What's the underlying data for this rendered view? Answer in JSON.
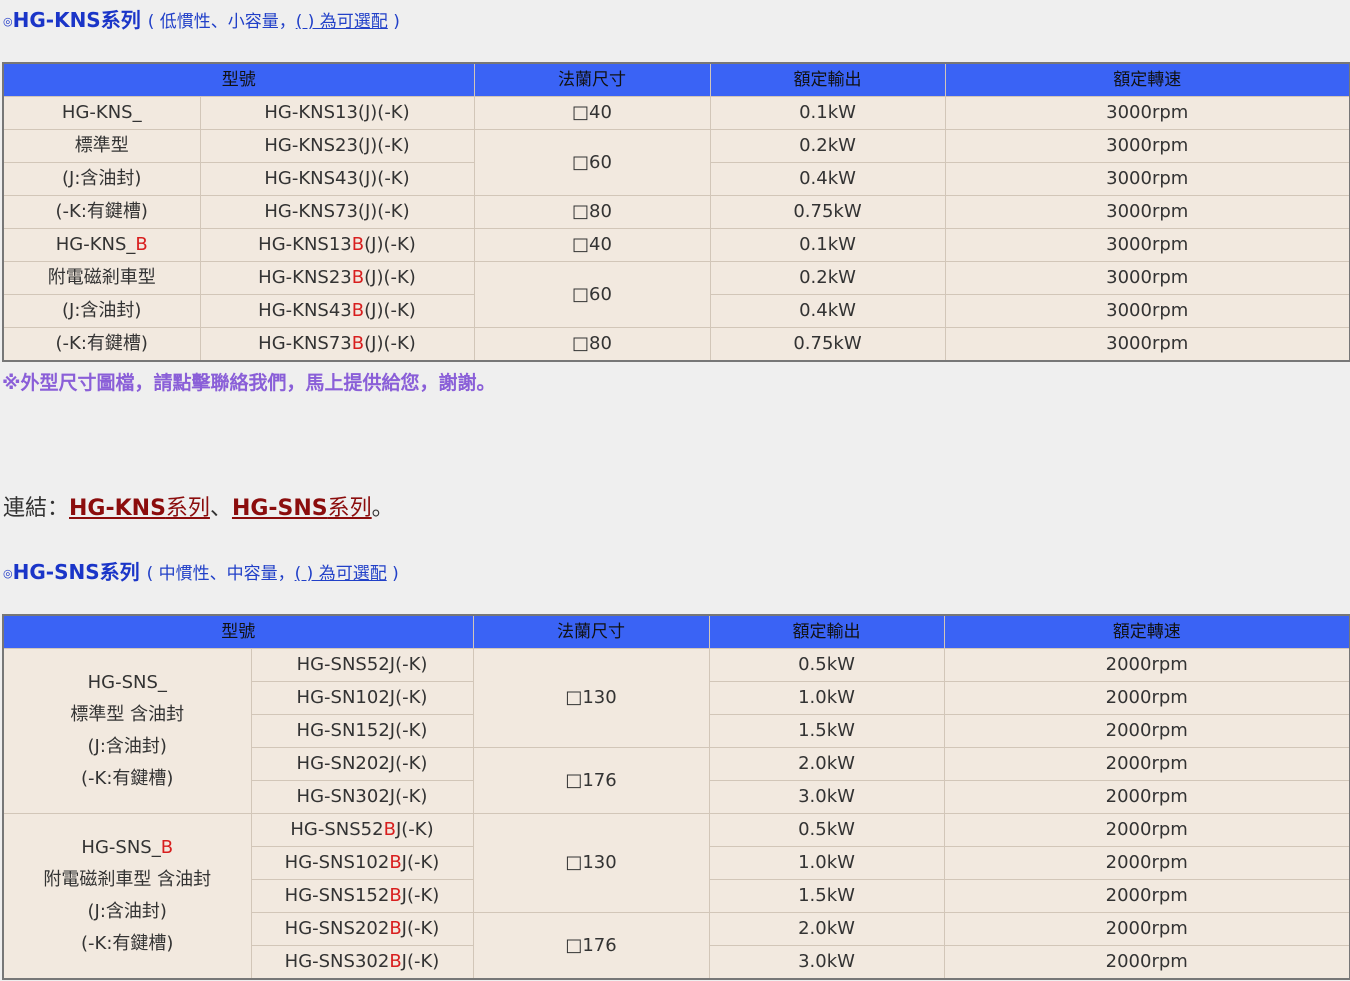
{
  "kns": {
    "bullet": "◎",
    "title": "HG-KNS系列",
    "sub_pre": "( 低慣性、小容量，",
    "sub_link": "( ) 為可選配",
    "sub_post": " )",
    "headers": [
      "型號",
      "法蘭尺寸",
      "額定輸出",
      "額定轉速"
    ],
    "group1": {
      "line1": "HG-KNS_",
      "line2": "標準型",
      "line3": "(J:含油封)",
      "line4": "(-K:有鍵槽)"
    },
    "group2": {
      "line1": "HG-KNS_",
      "line1_red": "B",
      "line2": "附電磁剎車型",
      "line3": "(J:含油封)",
      "line4": "(-K:有鍵槽)"
    },
    "rows": [
      {
        "model": "HG-KNS13(J)(-K)",
        "output": "0.1kW",
        "speed": "3000rpm"
      },
      {
        "model": "HG-KNS23(J)(-K)",
        "output": "0.2kW",
        "speed": "3000rpm"
      },
      {
        "model": "HG-KNS43(J)(-K)",
        "output": "0.4kW",
        "speed": "3000rpm"
      },
      {
        "model": "HG-KNS73(J)(-K)",
        "output": "0.75kW",
        "speed": "3000rpm"
      }
    ],
    "rows_b": [
      {
        "pre": "HG-KNS13",
        "red": "B",
        "post": "(J)(-K)",
        "output": "0.1kW",
        "speed": "3000rpm"
      },
      {
        "pre": "HG-KNS23",
        "red": "B",
        "post": "(J)(-K)",
        "output": "0.2kW",
        "speed": "3000rpm"
      },
      {
        "pre": "HG-KNS43",
        "red": "B",
        "post": "(J)(-K)",
        "output": "0.4kW",
        "speed": "3000rpm"
      },
      {
        "pre": "HG-KNS73",
        "red": "B",
        "post": "(J)(-K)",
        "output": "0.75kW",
        "speed": "3000rpm"
      }
    ],
    "flange": {
      "f40": "□40",
      "f60": "□60",
      "f80": "□80"
    }
  },
  "note": "※外型尺寸圖檔，請點擊聯絡我們，馬上提供給您，謝謝。",
  "links": {
    "prefix": "連結：",
    "kns_bold": "HG-KNS",
    "kns_rest": "系列",
    "sep": "、",
    "sns_bold": "HG-SNS",
    "sns_rest": "系列",
    "suffix": "。"
  },
  "sns": {
    "bullet": "◎",
    "title": "HG-SNS系列",
    "sub_pre": "( 中慣性、中容量，",
    "sub_link": "( ) 為可選配",
    "sub_post": " )",
    "headers": [
      "型號",
      "法蘭尺寸",
      "額定輸出",
      "額定轉速"
    ],
    "group1": {
      "line1": "HG-SNS_",
      "line2": "標準型 含油封",
      "line3": "(J:含油封)",
      "line4": "(-K:有鍵槽)"
    },
    "group2": {
      "line1": "HG-SNS_",
      "line1_red": "B",
      "line2": "附電磁剎車型 含油封",
      "line3": "(J:含油封)",
      "line4": "(-K:有鍵槽)"
    },
    "rows": [
      {
        "model": "HG-SNS52J(-K)",
        "output": "0.5kW",
        "speed": "2000rpm"
      },
      {
        "model": "HG-SN102J(-K)",
        "output": "1.0kW",
        "speed": "2000rpm"
      },
      {
        "model": "HG-SN152J(-K)",
        "output": "1.5kW",
        "speed": "2000rpm"
      },
      {
        "model": "HG-SN202J(-K)",
        "output": "2.0kW",
        "speed": "2000rpm"
      },
      {
        "model": "HG-SN302J(-K)",
        "output": "3.0kW",
        "speed": "2000rpm"
      }
    ],
    "rows_b": [
      {
        "pre": "HG-SNS52",
        "red": "B",
        "post": "J(-K)",
        "output": "0.5kW",
        "speed": "2000rpm"
      },
      {
        "pre": "HG-SNS102",
        "red": "B",
        "post": "J(-K)",
        "output": "1.0kW",
        "speed": "2000rpm"
      },
      {
        "pre": "HG-SNS152",
        "red": "B",
        "post": "J(-K)",
        "output": "1.5kW",
        "speed": "2000rpm"
      },
      {
        "pre": "HG-SNS202",
        "red": "B",
        "post": "J(-K)",
        "output": "2.0kW",
        "speed": "2000rpm"
      },
      {
        "pre": "HG-SNS302",
        "red": "B",
        "post": "J(-K)",
        "output": "3.0kW",
        "speed": "2000rpm"
      }
    ],
    "flange": {
      "f130": "□130",
      "f176": "□176",
      "f130b": "□130",
      "f176b": "□176"
    }
  }
}
